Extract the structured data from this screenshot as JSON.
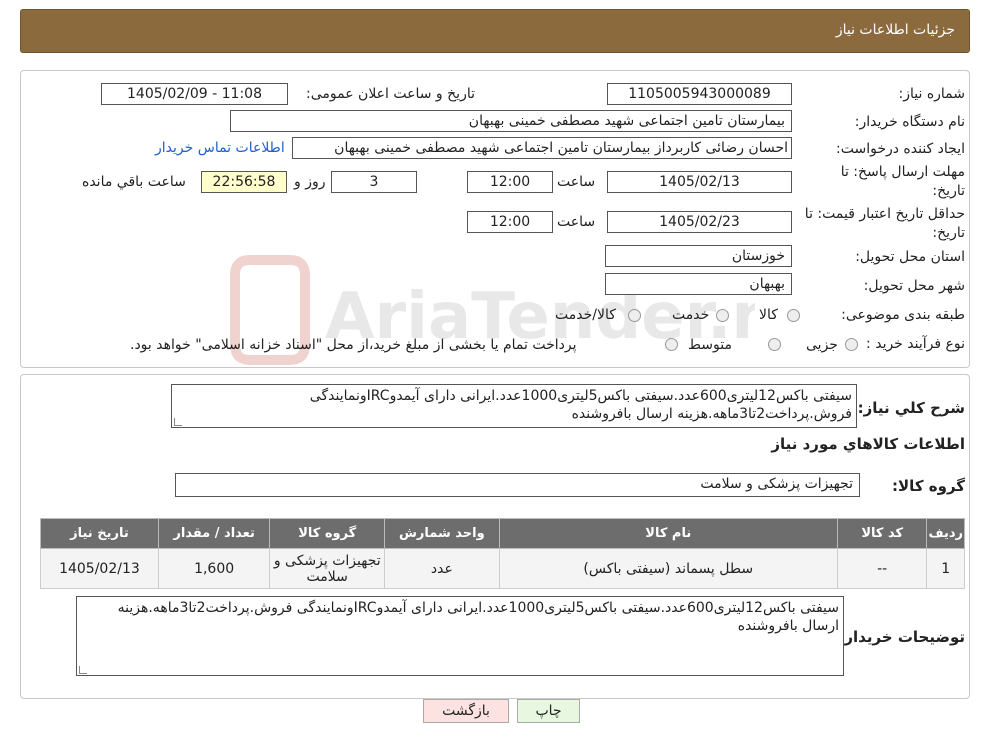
{
  "header": {
    "title": "جزئیات اطلاعات نیاز"
  },
  "form": {
    "need_number_label": "شماره نیاز:",
    "need_number": "1105005943000089",
    "announce_label": "تاریخ و ساعت اعلان عمومی:",
    "announce_value": "1405/02/09 - 11:08",
    "buyer_org_label": "نام دستگاه خریدار:",
    "buyer_org": "بیمارستان تامین اجتماعی شهید مصطفی خمینی بهبهان",
    "creator_label": "ایجاد کننده درخواست:",
    "creator": "احسان رضائی کاربرداز بیمارستان تامین اجتماعی شهید مصطفی خمینی بهبهان",
    "contact_link": "اطلاعات تماس خریدار",
    "deadline_label_1": "مهلت ارسال پاسخ: تا",
    "deadline_label_2": "تاریخ:",
    "deadline_date": "1405/02/13",
    "time_label": "ساعت",
    "deadline_time": "12:00",
    "days_value": "3",
    "days_label": "روز و",
    "remaining_time": "22:56:58",
    "remaining_label": "ساعت باقي مانده",
    "validity_label_1": "حداقل تاریخ اعتبار قیمت: تا",
    "validity_label_2": "تاریخ:",
    "validity_date": "1405/02/23",
    "validity_time": "12:00",
    "province_label": "استان محل تحویل:",
    "province": "خوزستان",
    "city_label": "شهر محل تحویل:",
    "city": "بهبهان",
    "category_label": "طبقه بندی موضوعی:",
    "category_options": [
      "کالا",
      "خدمت",
      "کالا/خدمت"
    ],
    "process_label": "نوع فرآیند خرید :",
    "process_options": [
      "جزیی",
      "متوسط"
    ],
    "process_note": "پرداخت تمام یا بخشی از مبلغ خرید،از محل \"اسناد خزانه اسلامی\" خواهد بود."
  },
  "description": {
    "label": "شرح کلي نياز:",
    "text": "سیفتی باکس12لیتری600عدد.سیفتی باکس5لیتری1000عدد.ایرانی دارای آیمدوIRCونمایندگی فروش.پرداخت2تا3ماهه.هزینه ارسال بافروشنده"
  },
  "goods": {
    "section_title": "اطلاعات کالاهاي مورد نياز",
    "group_label": "گروه کالا:",
    "group_value": "تجهیزات پزشکی و سلامت"
  },
  "table": {
    "headers": [
      "رديف",
      "کد کالا",
      "نام کالا",
      "واحد شمارش",
      "گروه کالا",
      "تعداد / مقدار",
      "تاريخ نياز"
    ],
    "rows": [
      [
        "1",
        "--",
        "سطل پسماند (سیفتی باکس)",
        "عدد",
        "تجهیزات پزشکی و سلامت",
        "1,600",
        "1405/02/13"
      ]
    ]
  },
  "buyer_notes": {
    "label": "توضيحات خريدار:",
    "text": "سیفتی باکس12لیتری600عدد.سیفتی باکس5لیتری1000عدد.ایرانی دارای آیمدوIRCونمایندگی فروش.پرداخت2تا3ماهه.هزینه ارسال بافروشنده"
  },
  "buttons": {
    "print": "چاپ",
    "back": "بازگشت"
  },
  "watermark": {
    "text": "AriaTender.neT"
  },
  "colors": {
    "header_bg": "#8b6a3e",
    "link": "#1b5fd0",
    "table_header": "#6d6d6d",
    "back_btn": "#fde2e2",
    "print_btn": "#e8f8e0"
  }
}
